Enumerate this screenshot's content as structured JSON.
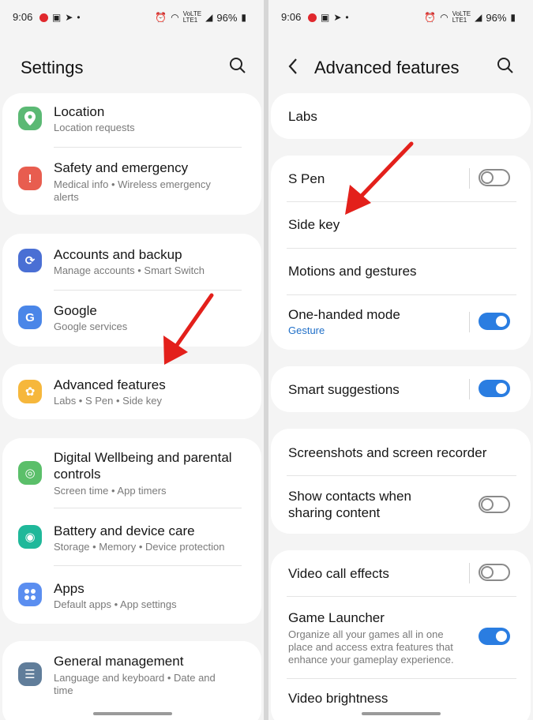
{
  "status": {
    "left_time": "9:06",
    "right_time": "9:06",
    "battery": "96%",
    "volte_top": "VoLTE",
    "volte_bottom": "LTE1"
  },
  "settings": {
    "title": "Settings",
    "items": [
      {
        "label": "Location",
        "sub": "Location requests"
      },
      {
        "label": "Safety and emergency",
        "sub": "Medical info  •  Wireless emergency",
        "sub2": "alerts"
      },
      {
        "label": "Accounts and backup",
        "sub": "Manage accounts  •  Smart Switch"
      },
      {
        "label": "Google",
        "sub": "Google services"
      },
      {
        "label": "Advanced features",
        "sub": "Labs  •  S Pen  •  Side key"
      },
      {
        "label": "Digital Wellbeing and parental",
        "label2": "controls",
        "sub": "Screen time  •  App timers"
      },
      {
        "label": "Battery and device care",
        "sub": "Storage  •  Memory  •  Device protection"
      },
      {
        "label": "Apps",
        "sub": "Default apps  •  App settings"
      },
      {
        "label": "General management",
        "sub": "Language and keyboard  •  Date and",
        "sub2": "time"
      }
    ]
  },
  "advanced": {
    "title": "Advanced features",
    "items": [
      {
        "label": "Labs"
      },
      {
        "label": "S Pen",
        "toggle": "off"
      },
      {
        "label": "Side key"
      },
      {
        "label": "Motions and gestures"
      },
      {
        "label": "One-handed mode",
        "sub": "Gesture",
        "toggle": "on"
      },
      {
        "label": "Smart suggestions",
        "toggle": "on"
      },
      {
        "label": "Screenshots and screen recorder"
      },
      {
        "label": "Show contacts when",
        "label2": "sharing content",
        "toggle": "off"
      },
      {
        "label": "Video call effects",
        "toggle": "off"
      },
      {
        "label": "Game Launcher",
        "sub": "Organize all your games all in one",
        "sub2": "place and access extra features that",
        "sub3": "enhance your gameplay experience.",
        "toggle": "on"
      },
      {
        "label": "Video brightness"
      }
    ]
  },
  "icons": {
    "location": "location-pin-icon",
    "safety": "alert-icon",
    "accounts": "sync-icon",
    "google": "google-icon",
    "advanced": "advanced-features-icon",
    "wellbeing": "wellbeing-icon",
    "battery": "battery-care-icon",
    "apps": "apps-grid-icon",
    "general": "sliders-icon"
  },
  "colors": {
    "accent_blue": "#2a7de1",
    "arrow_red": "#e3201b",
    "location_green": "#5bb974",
    "safety_red": "#e85d4f",
    "accounts_blue": "#4a6fd4",
    "google_blue": "#4a86e8",
    "advanced_yellow": "#f6b73c",
    "wellbeing_green": "#5bbf6a",
    "battery_teal": "#1fb89a",
    "apps_blue": "#5b8ef0",
    "general_slate": "#607d9a"
  }
}
